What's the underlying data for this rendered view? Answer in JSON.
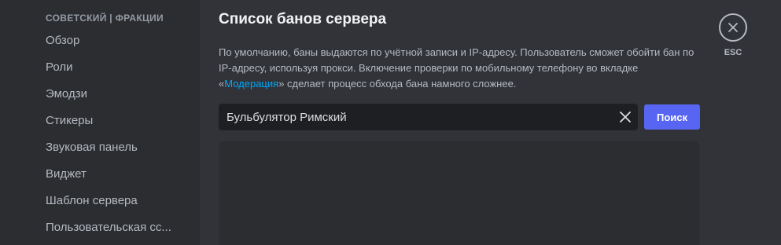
{
  "sidebar": {
    "header": "СОВЕТСКИЙ | ФРАКЦИИ",
    "items": [
      {
        "label": "Обзор"
      },
      {
        "label": "Роли"
      },
      {
        "label": "Эмодзи"
      },
      {
        "label": "Стикеры"
      },
      {
        "label": "Звуковая панель"
      },
      {
        "label": "Виджет"
      },
      {
        "label": "Шаблон сервера"
      },
      {
        "label": "Пользовательская сс..."
      }
    ]
  },
  "main": {
    "title": "Список банов сервера",
    "description": {
      "text_before": "По умолчанию, баны выдаются по учётной записи и IP-адресу. Пользователь сможет обойти бан по IP-адресу, используя прокси. Включение проверки по мобильному телефону во вкладке «",
      "link": "Модерация",
      "text_after": "» сделает процесс обхода бана намного сложнее."
    },
    "search": {
      "value": "Бульбулятор Римский",
      "button_label": "Поиск"
    }
  },
  "close": {
    "label": "ESC"
  },
  "colors": {
    "accent": "#5865f2",
    "link": "#00a8fc"
  }
}
